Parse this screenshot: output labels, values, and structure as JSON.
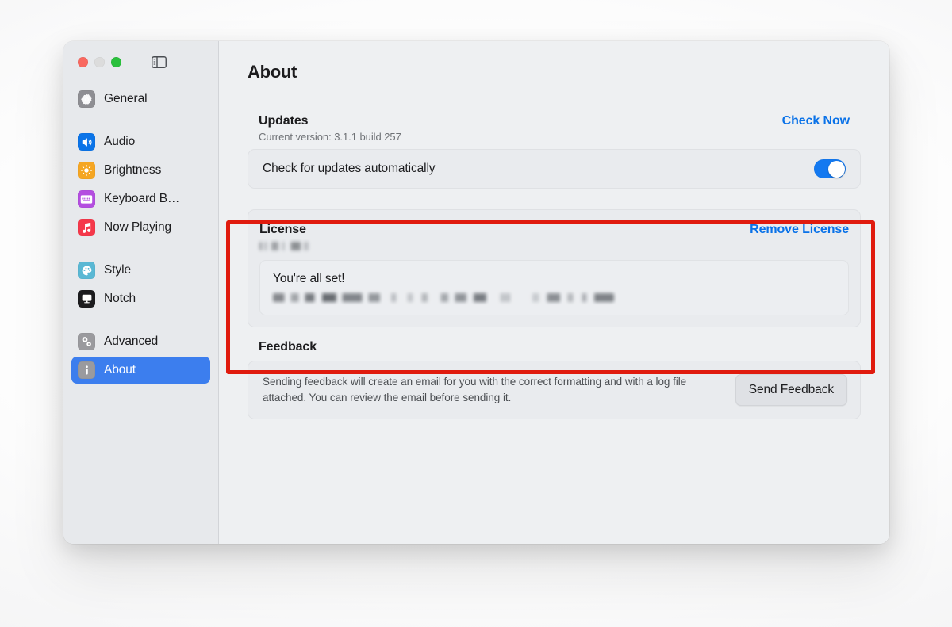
{
  "window": {
    "traffic_lights": [
      {
        "name": "close",
        "color": "#f9685f"
      },
      {
        "name": "minimize",
        "color": "#dcdcdc"
      },
      {
        "name": "zoom",
        "color": "#2ac03c"
      }
    ],
    "sidebar_toggle_icon": "sidebar-toggle-icon"
  },
  "sidebar": {
    "groups": [
      {
        "items": [
          {
            "label": "General",
            "icon": "gear-icon",
            "icon_color": "#8e8e93",
            "selected": false
          }
        ]
      },
      {
        "items": [
          {
            "label": "Audio",
            "icon": "speaker-icon",
            "icon_color": "#0b74e8",
            "selected": false
          },
          {
            "label": "Brightness",
            "icon": "sun-icon",
            "icon_color": "#f5a623",
            "selected": false
          },
          {
            "label": "Keyboard B…",
            "icon": "keyboard-icon",
            "icon_color": "#b44ee0",
            "selected": false
          },
          {
            "label": "Now Playing",
            "icon": "music-note-icon",
            "icon_color": "#f5384a",
            "selected": false
          }
        ]
      },
      {
        "items": [
          {
            "label": "Style",
            "icon": "palette-icon",
            "icon_color": "#5ab8d4",
            "selected": false
          },
          {
            "label": "Notch",
            "icon": "display-icon",
            "icon_color": "#1c1c1e",
            "selected": false
          }
        ]
      },
      {
        "items": [
          {
            "label": "Advanced",
            "icon": "gears-icon",
            "icon_color": "#9a9a9e",
            "selected": false
          },
          {
            "label": "About",
            "icon": "info-icon",
            "icon_color": "#9a9a9e",
            "selected": true
          }
        ]
      }
    ]
  },
  "main": {
    "page_title": "About",
    "updates": {
      "title": "Updates",
      "subtitle": "Current version: 3.1.1 build 257",
      "action_label": "Check Now",
      "auto_update_label": "Check for updates automatically",
      "auto_update_on": true
    },
    "license": {
      "title": "License",
      "redacted_identifier": "",
      "action_label": "Remove License",
      "status_title": "You're all set!",
      "redacted_details": ""
    },
    "feedback": {
      "title": "Feedback",
      "description": "Sending feedback will create an email for you with the correct formatting and with a log file attached. You can review the email before sending it.",
      "button_label": "Send Feedback"
    }
  },
  "annotation": {
    "highlight_color": "#e01b0e",
    "highlights": "license-section"
  },
  "colors": {
    "accent_blue": "#0a72e8",
    "toggle_on": "#1479f0",
    "selection_blue": "#3c7eee",
    "window_bg": "#eef0f2",
    "sidebar_bg": "#e7e9ec"
  }
}
